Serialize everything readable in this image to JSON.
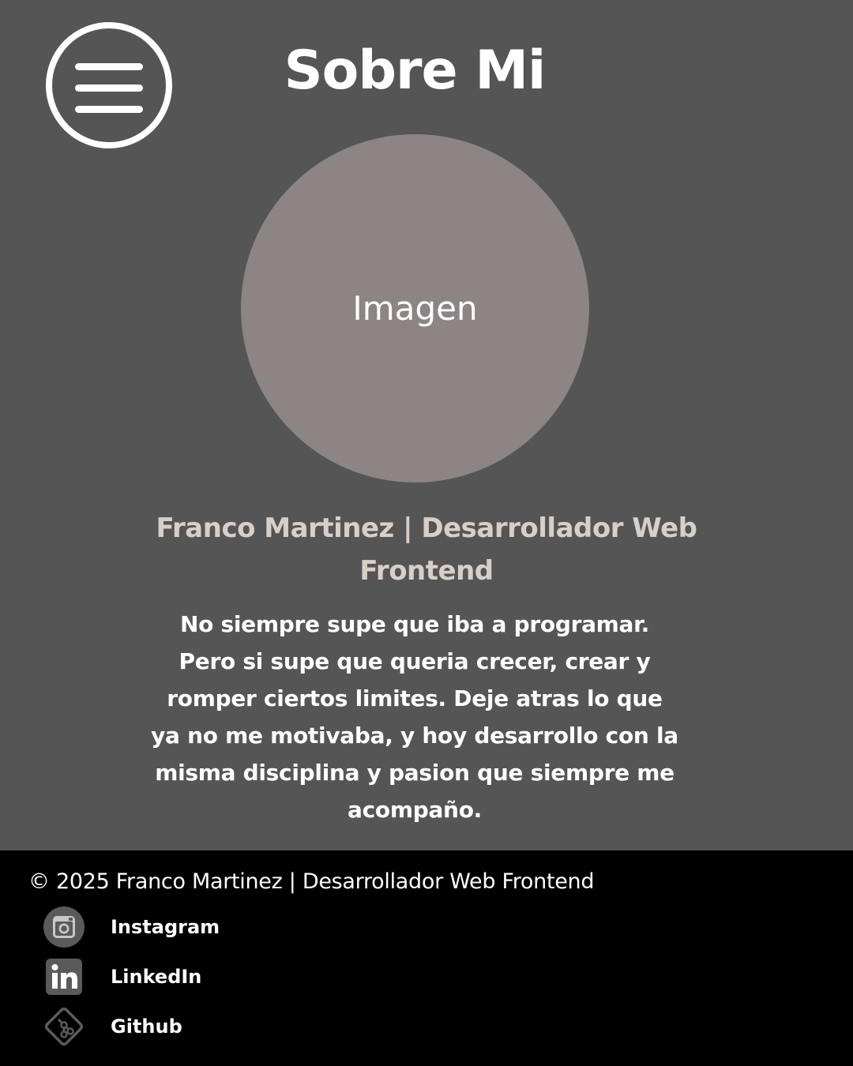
{
  "header": {
    "title": "Sobre Mi",
    "menu_icon": "hamburger-menu-icon"
  },
  "profile": {
    "image_placeholder": "Imagen",
    "headline": "Franco Martinez  | Desarrollador Web Frontend",
    "bio": "No siempre supe que iba a programar. Pero si supe que queria crecer, crear y romper ciertos limites. Deje atras lo que ya no me motivaba, y hoy desarrollo con la misma disciplina y pasion que siempre me acompaño."
  },
  "footer": {
    "copyright": "© 2025 Franco Martinez | Desarrollador Web Frontend",
    "links": [
      {
        "label": "Instagram",
        "icon": "instagram-icon"
      },
      {
        "label": "LinkedIn",
        "icon": "linkedin-icon"
      },
      {
        "label": "Github",
        "icon": "git-icon"
      }
    ]
  },
  "colors": {
    "background": "#555555",
    "avatar": "#8c8485",
    "headline": "#d8cfc8",
    "footer_bg": "#000000",
    "text": "#ffffff"
  }
}
